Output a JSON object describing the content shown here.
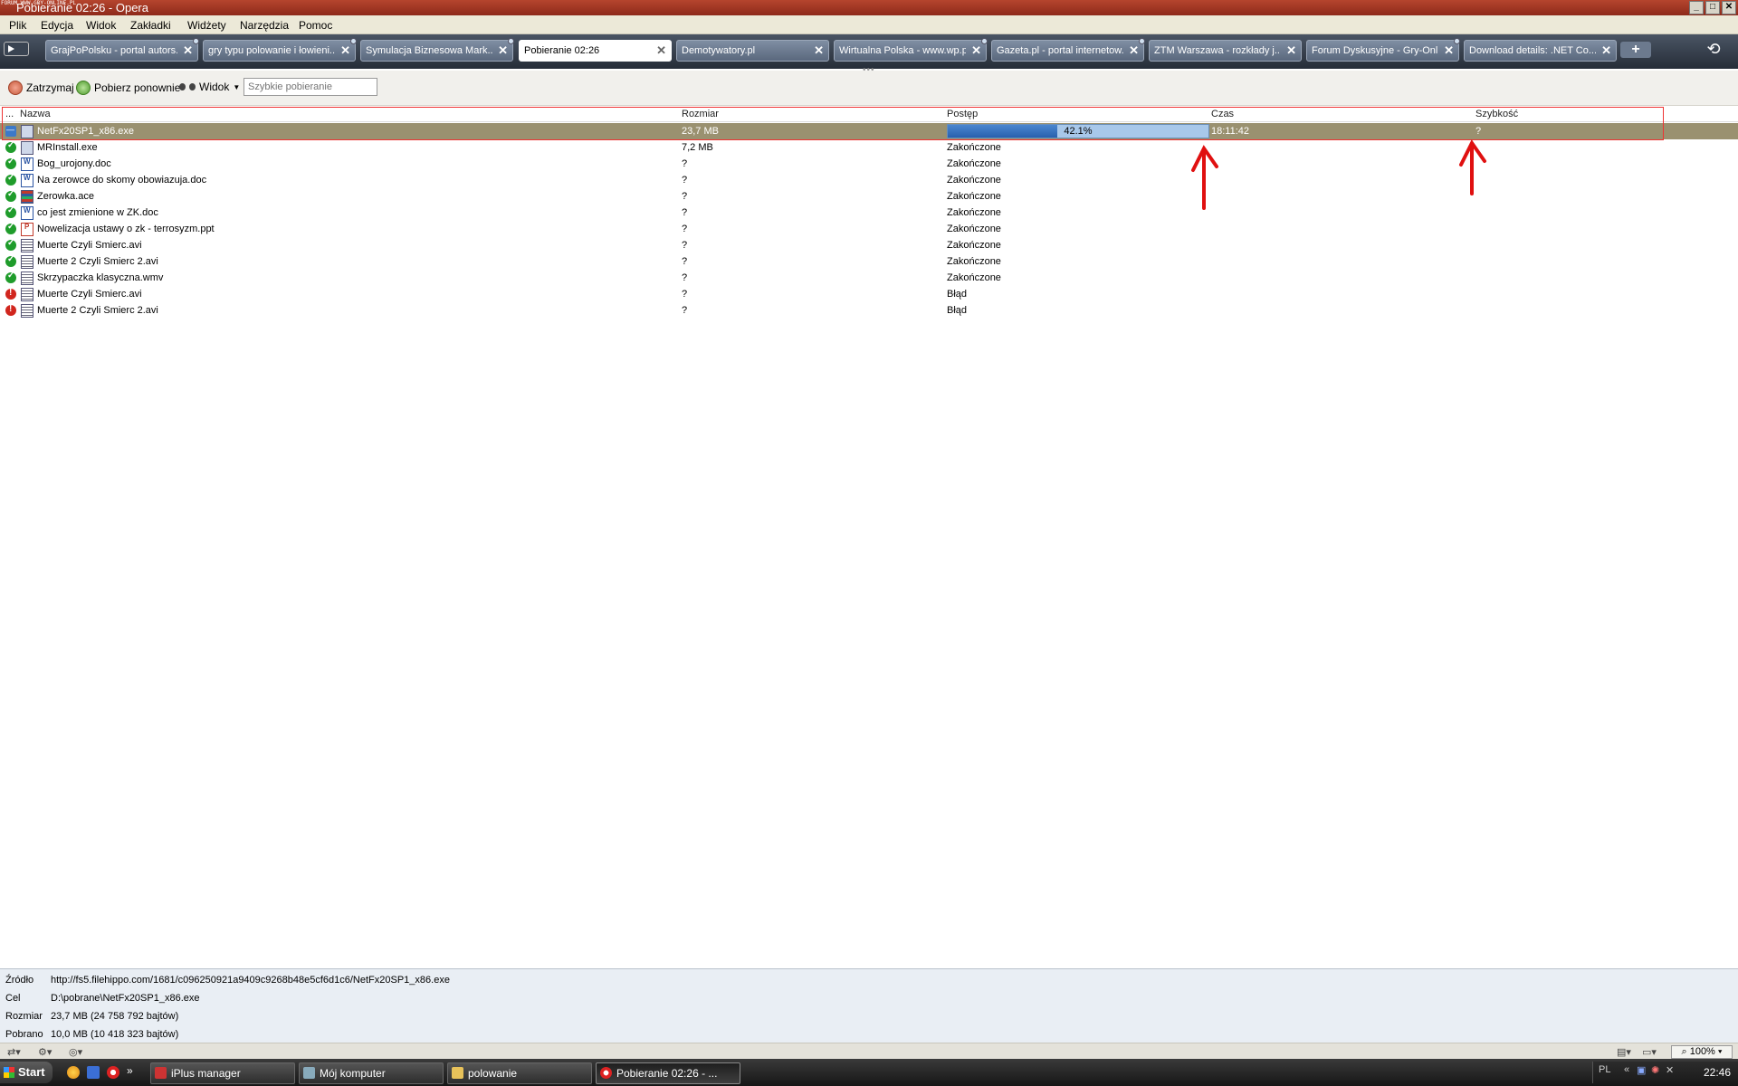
{
  "window": {
    "title": "Pobieranie 02:26 - Opera",
    "stamp": "FORUM WWW.GRY-ONLINE.PL",
    "controls": [
      "_",
      "□",
      "✕"
    ]
  },
  "menu": [
    "Plik",
    "Edycja",
    "Widok",
    "Zakładki",
    "Widżety",
    "Narzędzia",
    "Pomoc"
  ],
  "tabs": [
    {
      "label": "GrajPoPolsku - portal autors...",
      "active": false
    },
    {
      "label": "gry typu polowanie i łowieni...",
      "active": false
    },
    {
      "label": "Symulacja Biznesowa Mark...",
      "active": false
    },
    {
      "label": "Pobieranie 02:26",
      "active": true
    },
    {
      "label": "Demotywatory.pl",
      "active": false
    },
    {
      "label": "Wirtualna Polska - www.wp.pl",
      "active": false
    },
    {
      "label": "Gazeta.pl - portal internetow...",
      "active": false
    },
    {
      "label": "ZTM Warszawa - rozkłady j...",
      "active": false
    },
    {
      "label": "Forum Dyskusyjne - Gry-Onli...",
      "active": false
    },
    {
      "label": "Download details: .NET Co...",
      "active": false
    }
  ],
  "tab_close": "✕",
  "new_tab": "+",
  "toolbar": {
    "stop": "Zatrzymaj",
    "retry": "Pobierz ponownie",
    "view": "Widok",
    "quick_placeholder": "Szybkie pobieranie"
  },
  "columns": {
    "menu": "...",
    "name": "Nazwa",
    "size": "Rozmiar",
    "progress": "Postęp",
    "time": "Czas",
    "speed": "Szybkość"
  },
  "downloads": [
    {
      "name": "NetFx20SP1_x86.exe",
      "size": "23,7 MB",
      "progress": "42.1%",
      "progress_value": 0.421,
      "time": "18:11:42",
      "speed": "?",
      "status": "downloading",
      "icon": "exe"
    },
    {
      "name": "MRInstall.exe",
      "size": "7,2 MB",
      "progress": "Zakończone",
      "time": "",
      "speed": "",
      "status": "done",
      "icon": "exe"
    },
    {
      "name": "Bog_urojony.doc",
      "size": "?",
      "progress": "Zakończone",
      "time": "",
      "speed": "",
      "status": "done",
      "icon": "doc"
    },
    {
      "name": "Na zerowce do skomy obowiazuja.doc",
      "size": "?",
      "progress": "Zakończone",
      "time": "",
      "speed": "",
      "status": "done",
      "icon": "doc"
    },
    {
      "name": "Zerowka.ace",
      "size": "?",
      "progress": "Zakończone",
      "time": "",
      "speed": "",
      "status": "done",
      "icon": "ace"
    },
    {
      "name": "co jest zmienione w ZK.doc",
      "size": "?",
      "progress": "Zakończone",
      "time": "",
      "speed": "",
      "status": "done",
      "icon": "doc"
    },
    {
      "name": "Nowelizacja ustawy o zk - terrosyzm.ppt",
      "size": "?",
      "progress": "Zakończone",
      "time": "",
      "speed": "",
      "status": "done",
      "icon": "ppt"
    },
    {
      "name": "Muerte Czyli Smierc.avi",
      "size": "?",
      "progress": "Zakończone",
      "time": "",
      "speed": "",
      "status": "done",
      "icon": "avi"
    },
    {
      "name": "Muerte 2 Czyli Smierc 2.avi",
      "size": "?",
      "progress": "Zakończone",
      "time": "",
      "speed": "",
      "status": "done",
      "icon": "avi"
    },
    {
      "name": "Skrzypaczka klasyczna.wmv",
      "size": "?",
      "progress": "Zakończone",
      "time": "",
      "speed": "",
      "status": "done",
      "icon": "avi"
    },
    {
      "name": "Muerte Czyli Smierc.avi",
      "size": "?",
      "progress": "Błąd",
      "time": "",
      "speed": "",
      "status": "error",
      "icon": "avi"
    },
    {
      "name": "Muerte 2 Czyli Smierc 2.avi",
      "size": "?",
      "progress": "Błąd",
      "time": "",
      "speed": "",
      "status": "error",
      "icon": "avi"
    }
  ],
  "details": {
    "source_label": "Źródło",
    "source": "http://fs5.filehippo.com/1681/c096250921a9409c9268b48e5cf6d1c6/NetFx20SP1_x86.exe",
    "target_label": "Cel",
    "target": "D:\\pobrane\\NetFx20SP1_x86.exe",
    "size_label": "Rozmiar",
    "size": "23,7 MB (24 758 792 bajtów)",
    "downloaded_label": "Pobrano",
    "downloaded": "10,0 MB (10 418 323 bajtów)"
  },
  "statusbar": {
    "zoom": "100%"
  },
  "taskbar": {
    "start": "Start",
    "quicklaunch_more": "»",
    "buttons": [
      {
        "label": "iPlus manager",
        "active": false
      },
      {
        "label": "Mój komputer",
        "active": false
      },
      {
        "label": "polowanie",
        "active": false
      },
      {
        "label": "Pobieranie 02:26 - ...",
        "active": true
      }
    ],
    "clock": "22:46"
  },
  "colors": {
    "selected_row": "#9a9170",
    "progress_fill": "#2860ad",
    "annotation": "#e01010"
  }
}
